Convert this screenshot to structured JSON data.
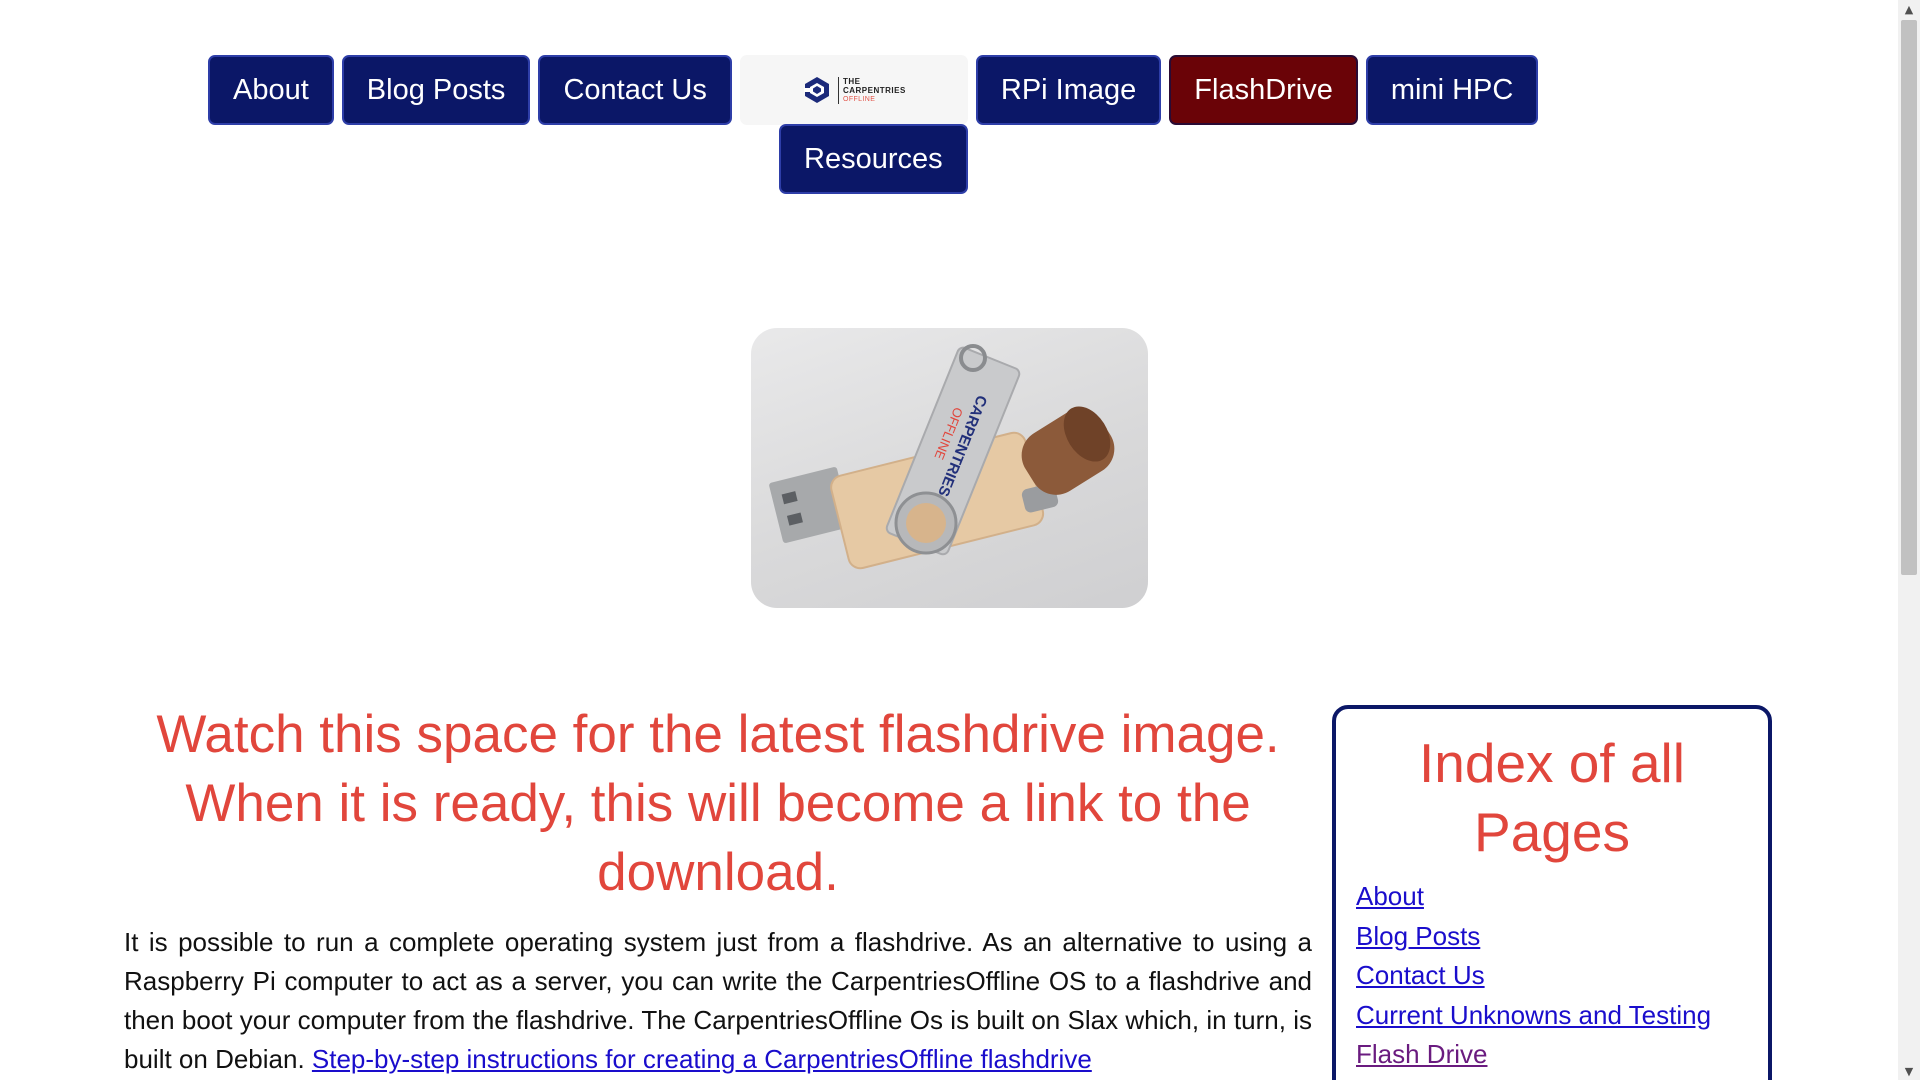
{
  "nav": {
    "about": "About",
    "blog_posts": "Blog Posts",
    "contact_us": "Contact Us",
    "logo": {
      "line1": "THE",
      "line2": "CARPENTRIES",
      "line3": "OFFLINE"
    },
    "rpi_image": "RPi Image",
    "flashdrive": "FlashDrive",
    "mini_hpc": "mini HPC",
    "resources": "Resources",
    "active_item": "FlashDrive"
  },
  "hero_image": {
    "drive_label_line1": "CARPENTRIES",
    "drive_label_line2": "OFFLINE"
  },
  "main": {
    "heading": "Watch this space for the latest flashdrive image. When it is ready, this will become a link to the download.",
    "intro_text": "It is possible to run a complete operating system just from a flashdrive. As an alternative to using a Raspberry Pi computer to act as a server, you can write the CarpentriesOffline OS to a flashdrive and then boot your computer from the flashdrive. The CarpentriesOffline Os is built on Slax which, in turn, is built on Debian. ",
    "intro_link": "Step-by-step instructions for creating a CarpentriesOffline flashdrive"
  },
  "sidebar": {
    "title": "Index of all Pages",
    "items": [
      {
        "label": "About",
        "visited": false
      },
      {
        "label": "Blog Posts",
        "visited": false
      },
      {
        "label": "Contact Us",
        "visited": false
      },
      {
        "label": "Current Unknowns and Testing",
        "visited": false
      },
      {
        "label": "Flash Drive",
        "visited": true
      }
    ]
  },
  "colors": {
    "nav_bg": "#0b1767",
    "nav_active_bg": "#6a0307",
    "heading": "#e1463c",
    "link": "#1a0dcc",
    "link_visited": "#6a1b7f",
    "sidebar_border": "#0b1767"
  },
  "icons": {
    "logo": "carpentries-offline-logo-icon",
    "scroll_up": "scroll-up-arrow-icon",
    "scroll_down": "scroll-down-arrow-icon"
  }
}
